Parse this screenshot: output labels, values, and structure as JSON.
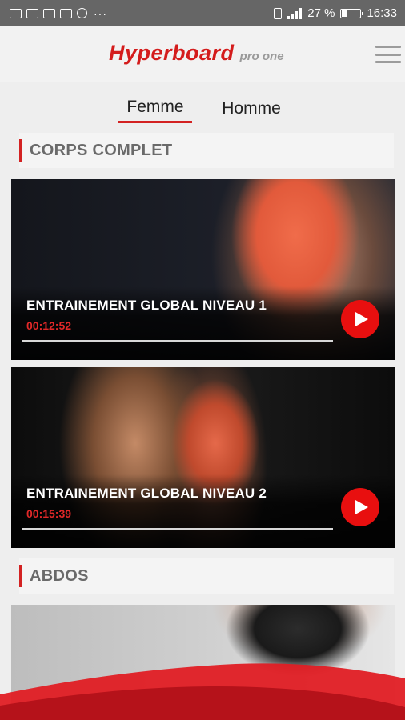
{
  "status_bar": {
    "battery": "27 %",
    "time": "16:33",
    "more": "···",
    "battery_level": 0.27
  },
  "header": {
    "logo_main": "Hyperboard",
    "logo_sub": "pro one"
  },
  "tabs": [
    {
      "label": "Femme",
      "selected": true
    },
    {
      "label": "Homme",
      "selected": false
    }
  ],
  "sections": [
    {
      "title": "CORPS COMPLET",
      "cards": [
        {
          "title": "ENTRAINEMENT GLOBAL NIVEAU 1",
          "duration": "00:12:52"
        },
        {
          "title": "ENTRAINEMENT GLOBAL NIVEAU 2",
          "duration": "00:15:39"
        }
      ]
    },
    {
      "title": "ABDOS",
      "cards": []
    }
  ],
  "colors": {
    "accent": "#d32222",
    "play": "#e80f0f",
    "status_bar": "#666666"
  }
}
